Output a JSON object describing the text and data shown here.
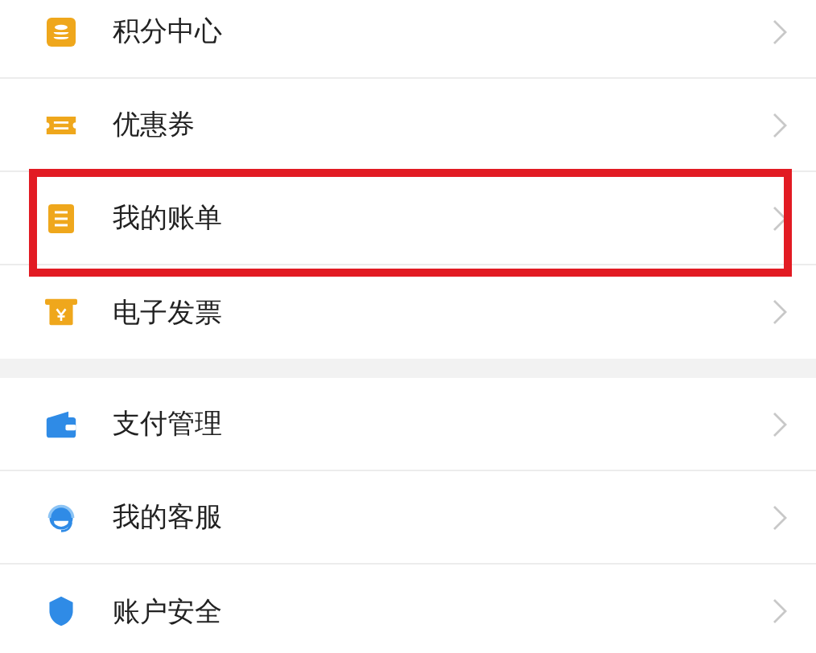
{
  "groups": [
    {
      "items": [
        {
          "kind": "points",
          "label": "积分中心",
          "highlighted": false
        },
        {
          "kind": "coupon",
          "label": "优惠券",
          "highlighted": false
        },
        {
          "kind": "bill",
          "label": "我的账单",
          "highlighted": true
        },
        {
          "kind": "invoice",
          "label": "电子发票",
          "highlighted": false
        }
      ]
    },
    {
      "items": [
        {
          "kind": "wallet",
          "label": "支付管理",
          "highlighted": false
        },
        {
          "kind": "service",
          "label": "我的客服",
          "highlighted": false
        },
        {
          "kind": "security",
          "label": "账户安全",
          "highlighted": false
        }
      ]
    }
  ]
}
